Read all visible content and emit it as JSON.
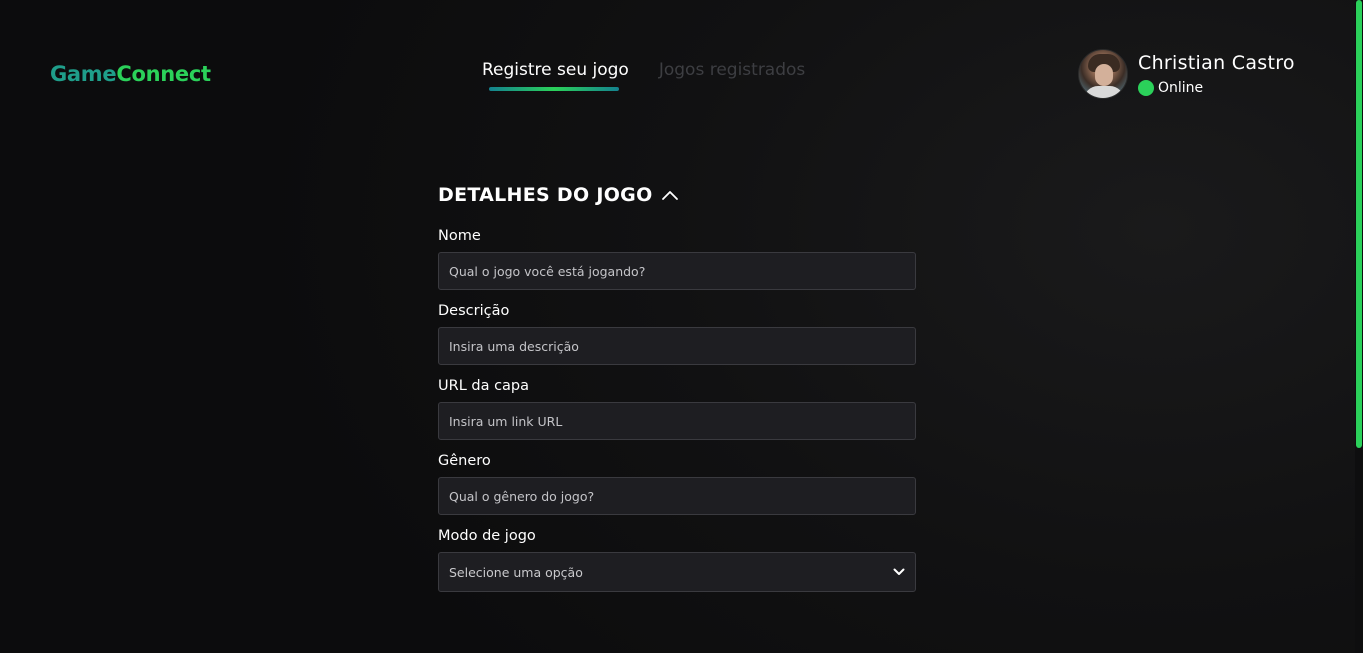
{
  "header": {
    "logo": {
      "part1": "Game",
      "part2": "Connect"
    },
    "nav": [
      {
        "label": "Registre seu jogo",
        "active": true
      },
      {
        "label": "Jogos registrados",
        "active": false
      }
    ],
    "profile": {
      "name": "Christian Castro",
      "status": "Online",
      "status_color": "#2bd15a"
    }
  },
  "section": {
    "title": "DETALHES DO JOGO",
    "expanded": true
  },
  "form": {
    "name": {
      "label": "Nome",
      "placeholder": "Qual o jogo você está jogando?"
    },
    "description": {
      "label": "Descrição",
      "placeholder": "Insira uma descrição"
    },
    "cover_url": {
      "label": "URL da capa",
      "placeholder": "Insira um link URL"
    },
    "genre": {
      "label": "Gênero",
      "placeholder": "Qual o gênero do jogo?"
    },
    "mode": {
      "label": "Modo de jogo",
      "selected": "Selecione uma opção"
    }
  },
  "colors": {
    "accent": "#2bd15a",
    "teal": "#1f9e8a",
    "background": "#0e0e0f",
    "input_bg": "#1e1e22"
  }
}
